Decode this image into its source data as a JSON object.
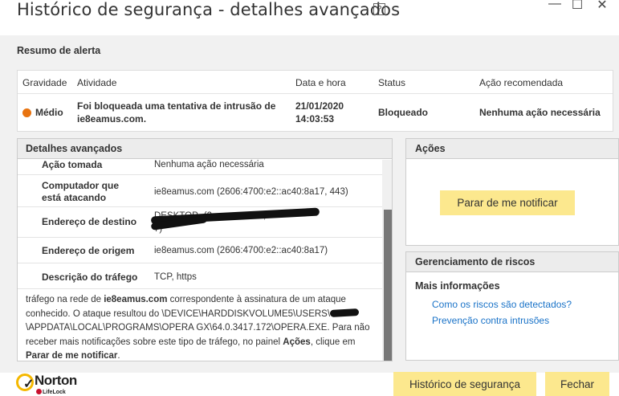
{
  "window": {
    "title": "Histórico de segurança - detalhes avançados",
    "help": "?",
    "minimize": "—",
    "maximize": "☐",
    "close": "✕"
  },
  "alert_summary": {
    "label": "Resumo de alerta",
    "columns": [
      "Gravidade",
      "Atividade",
      "Data e hora",
      "Status",
      "Ação recomendada"
    ],
    "row": {
      "severity": "Médio",
      "severity_color": "#e8730f",
      "activity_line1": "Foi bloqueada uma tentativa de intrusão de",
      "activity_line2": "ie8eamus.com.",
      "date": "21/01/2020",
      "time": "14:03:53",
      "status": "Bloqueado",
      "recommended_action": "Nenhuma ação necessária"
    }
  },
  "advanced": {
    "header": "Detalhes avançados",
    "rows": [
      {
        "key": "Ação tomada",
        "value": "Nenhuma ação necessária"
      },
      {
        "key_line1": "Computador que",
        "key_line2": "está atacando",
        "value": "ie8eamus.com (2606:4700:e2::ac40:8a17, 443)"
      },
      {
        "key": "Endereço de destino",
        "value_line1": "DESKTOP-           (2         ::          aee::1000,",
        "value_line2": "          7)"
      },
      {
        "key": "Endereço de origem",
        "value": "ie8eamus.com (2606:4700:e2::ac40:8a17)"
      },
      {
        "key": "Descrição do tráfego",
        "value": "TCP, https"
      }
    ],
    "description": {
      "p1": "tráfego na rede de ",
      "p1_bold": "ie8eamus.com",
      "p2": " correspondente à assinatura de um ataque conhecido. O ataque resultou do \\DEVICE\\HARDDISKVOLUME5\\USERS\\",
      "p3": "\\APPDATA\\LOCAL\\PROGRAMS\\OPERA GX\\64.0.3417.172\\OPERA.EXE. Para não receber mais notificações sobre este tipo de tráfego, no painel ",
      "p3_bold": "Ações",
      "p4": ", clique em ",
      "p4_bold": "Parar de me notificar",
      "p5": "."
    }
  },
  "actions": {
    "header": "Ações",
    "stop_button": "Parar de me notificar"
  },
  "risk": {
    "header": "Gerenciamento de riscos",
    "more_info": "Mais informações",
    "link1": "Como os riscos são detectados?",
    "link2": "Prevenção contra intrusões"
  },
  "footer": {
    "history_button": "Histórico de segurança",
    "close_button": "Fechar",
    "logo_name": "Norton",
    "logo_sub": "LifeLock"
  }
}
